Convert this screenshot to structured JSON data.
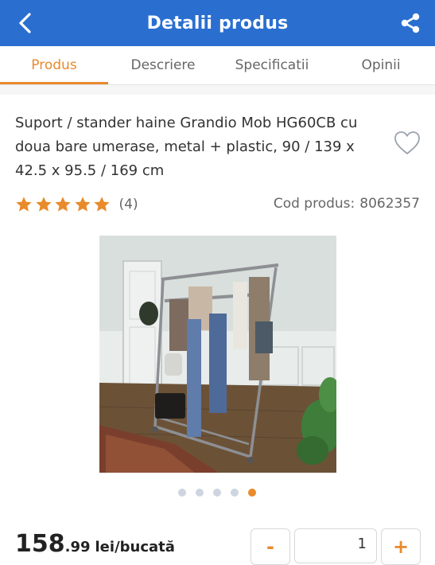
{
  "header": {
    "title": "Detalii produs",
    "back_icon": "chevron-left-icon",
    "share_icon": "share-icon"
  },
  "tabs": [
    {
      "label": "Produs",
      "active": true
    },
    {
      "label": "Descriere",
      "active": false
    },
    {
      "label": "Specificatii",
      "active": false
    },
    {
      "label": "Opinii",
      "active": false
    }
  ],
  "product": {
    "title": "Suport / stander haine Grandio Mob HG60CB cu doua bare umerase, metal + plastic, 90 / 139 x 42.5 x 95.5 / 169 cm",
    "rating_stars": 5,
    "rating_count": "(4)",
    "code_label": "Cod produs:",
    "code_value": "8062357",
    "favorite_icon": "heart-outline-icon"
  },
  "gallery": {
    "total": 5,
    "active_index": 4
  },
  "price": {
    "main": "158",
    "cents": ".99",
    "unit": "lei/bucată"
  },
  "quantity": {
    "minus_label": "-",
    "value": "1",
    "plus_label": "+"
  },
  "colors": {
    "header_blue": "#2a6fd0",
    "accent_orange": "#e98a2b"
  }
}
